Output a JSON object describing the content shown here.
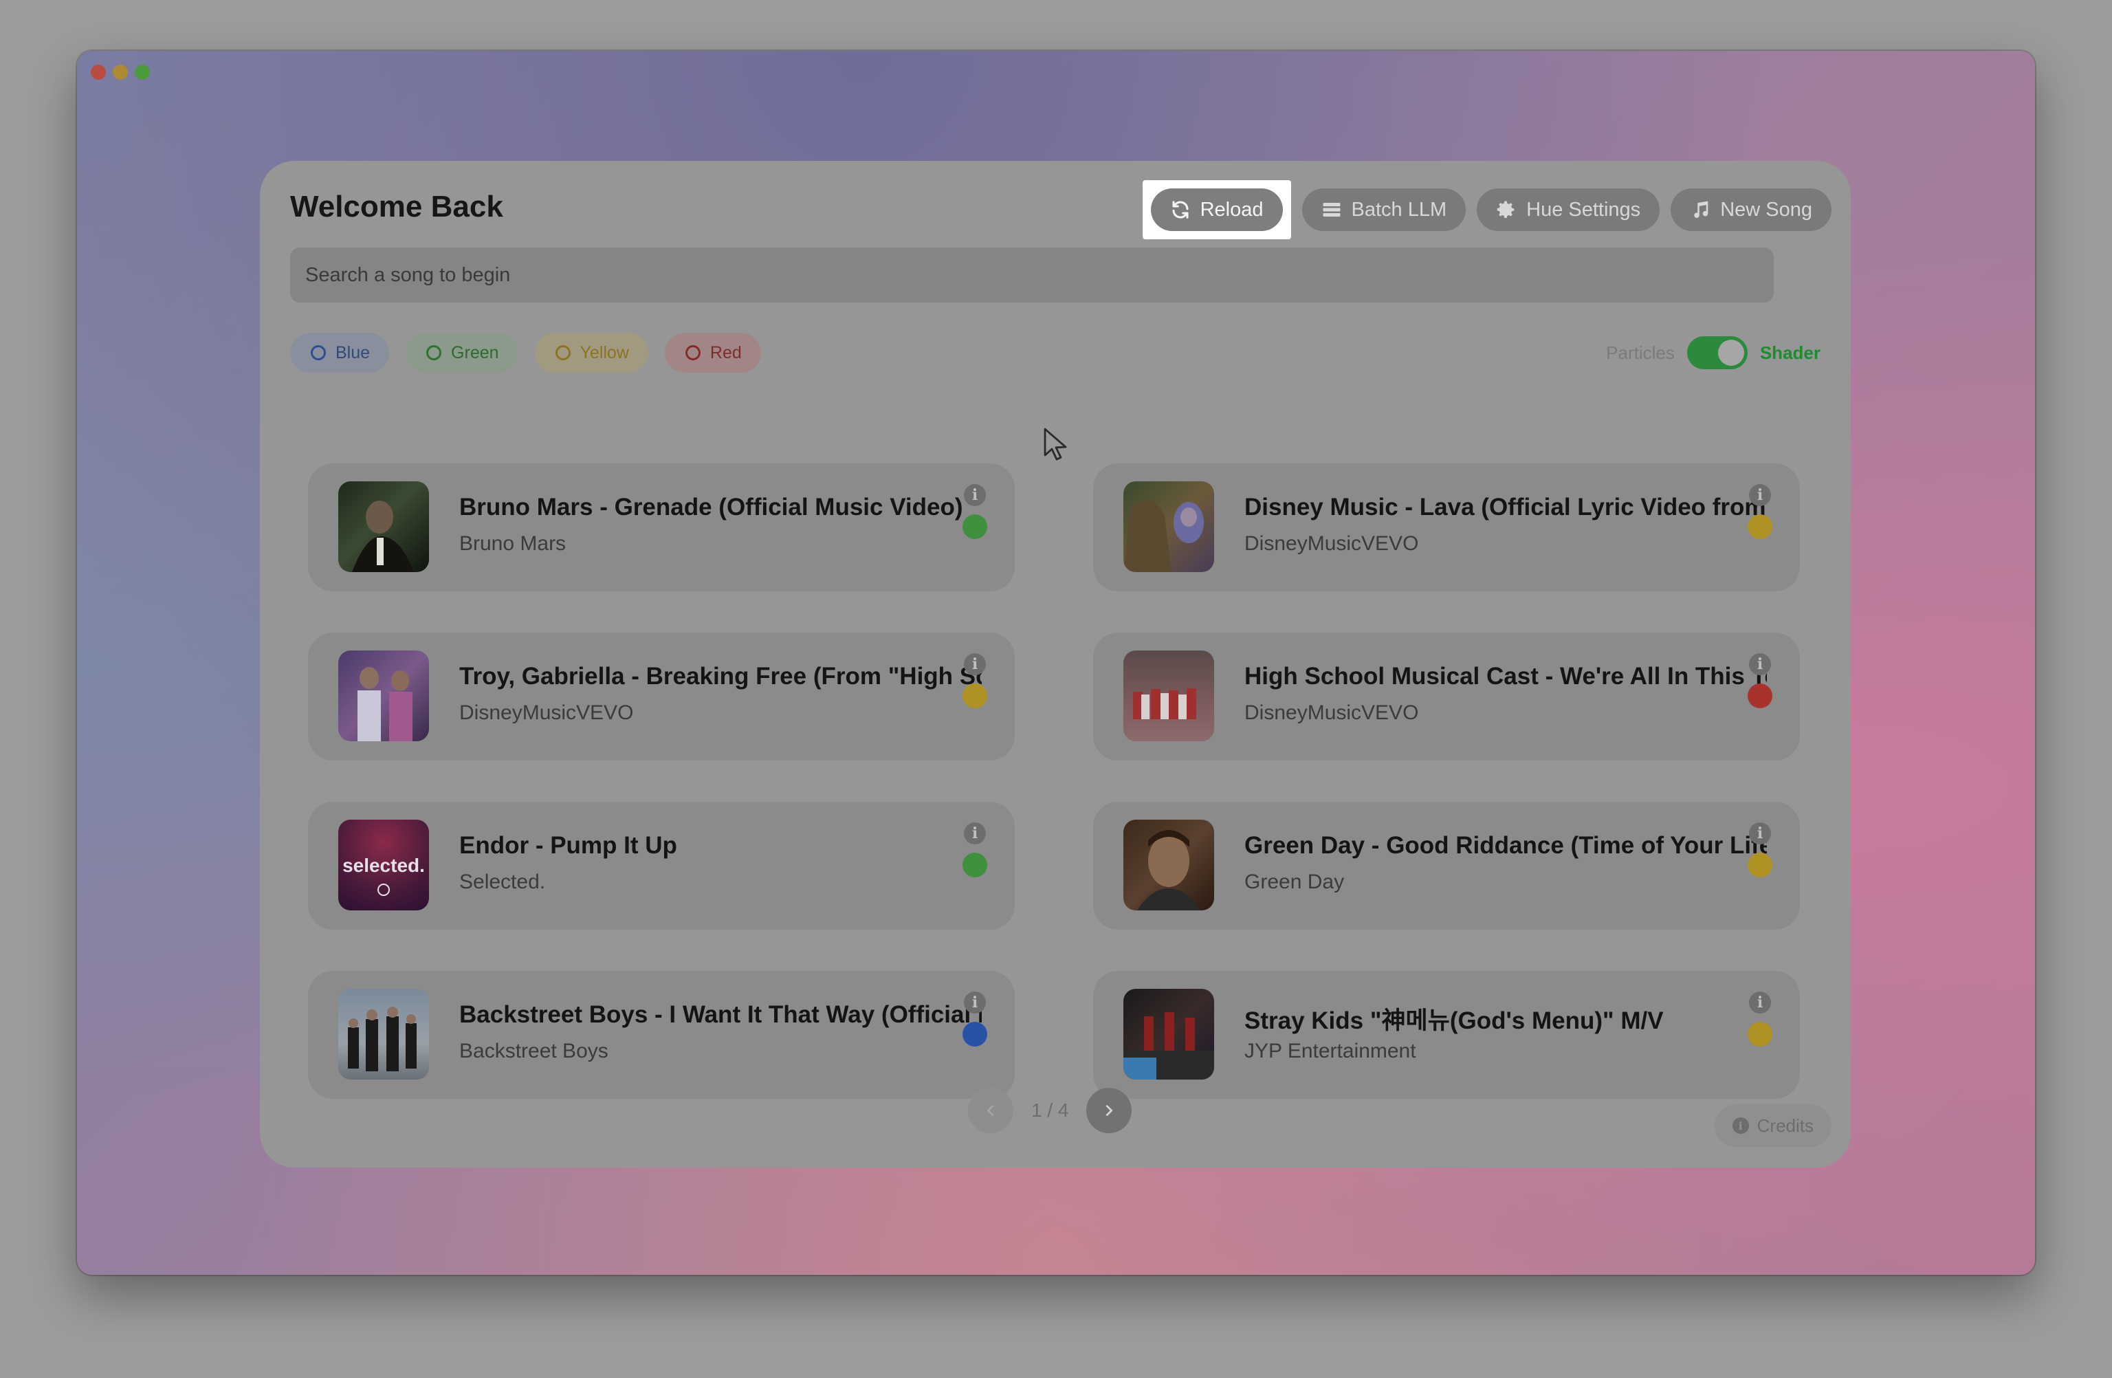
{
  "window": {
    "controls": [
      "close",
      "minimize",
      "maximize"
    ]
  },
  "header": {
    "title": "Welcome Back",
    "buttons": {
      "reload": {
        "label": "Reload",
        "icon": "refresh-icon"
      },
      "batch": {
        "label": "Batch LLM",
        "icon": "list-icon"
      },
      "hue": {
        "label": "Hue Settings",
        "icon": "gear-icon"
      },
      "new_song": {
        "label": "New Song",
        "icon": "music-note-icon"
      }
    }
  },
  "search": {
    "placeholder": "Search a song to begin"
  },
  "filters": [
    {
      "label": "Blue",
      "color": "#2c4f92"
    },
    {
      "label": "Green",
      "color": "#2f722f"
    },
    {
      "label": "Yellow",
      "color": "#8c7424"
    },
    {
      "label": "Red",
      "color": "#822b2b"
    }
  ],
  "mode_toggle": {
    "left": "Particles",
    "right": "Shader",
    "active": "Shader"
  },
  "songs": [
    {
      "title": "Bruno Mars - Grenade (Official Music Video)",
      "artist": "Bruno Mars",
      "color": "green"
    },
    {
      "title": "Disney Music - Lava (Official Lyric Video from Lava)",
      "artist": "DisneyMusicVEVO",
      "color": "yellow"
    },
    {
      "title": "Troy, Gabriella - Breaking Free (From \"High School Musical\")",
      "artist": "DisneyMusicVEVO",
      "color": "yellow"
    },
    {
      "title": "High School Musical Cast - We're All In This Together",
      "artist": "DisneyMusicVEVO",
      "color": "red"
    },
    {
      "title": "Endor - Pump It Up",
      "artist": "Selected.",
      "color": "green"
    },
    {
      "title": "Green Day - Good Riddance (Time of Your Life)",
      "artist": "Green Day",
      "color": "yellow"
    },
    {
      "title": "Backstreet Boys - I Want It That Way (Official Music Video)",
      "artist": "Backstreet Boys",
      "color": "blue"
    },
    {
      "title": "Stray Kids \"神메뉴(God's Menu)\" M/V",
      "artist": "JYP Entertainment",
      "color": "yellow"
    }
  ],
  "pagination": {
    "text": "1 / 4",
    "current": 1,
    "total": 4
  },
  "credits": {
    "label": "Credits"
  }
}
